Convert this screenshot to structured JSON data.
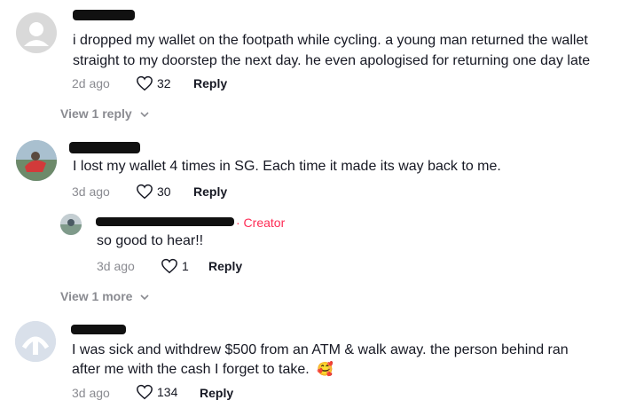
{
  "comments": [
    {
      "text_line1": "i dropped my wallet on the footpath while cycling. a young man returned the wallet",
      "text_line2": "straight to my doorstep the next day. he even apologised for returning one day late",
      "time": "2d ago",
      "likes": "32",
      "reply_label": "Reply",
      "view_replies": "View 1 reply"
    },
    {
      "text": "I lost my wallet 4 times in SG. Each time it made its way back to me.",
      "time": "3d ago",
      "likes": "30",
      "reply_label": "Reply",
      "reply": {
        "badge": "· Creator",
        "text": "so good to hear!!",
        "time": "3d ago",
        "likes": "1",
        "reply_label": "Reply"
      },
      "view_more": "View 1 more"
    },
    {
      "text_line1": "I was sick and withdrew $500 from an ATM & walk away. the person behind ran",
      "text_line2": "after me with the cash I forget to take.",
      "emoji": "🥰",
      "time": "3d ago",
      "likes": "134",
      "reply_label": "Reply"
    }
  ],
  "icons": {
    "like": "heart-outline-icon",
    "expand": "chevron-down-icon"
  },
  "colors": {
    "creator": "#fe2c55",
    "meta": "#8a8b91"
  }
}
